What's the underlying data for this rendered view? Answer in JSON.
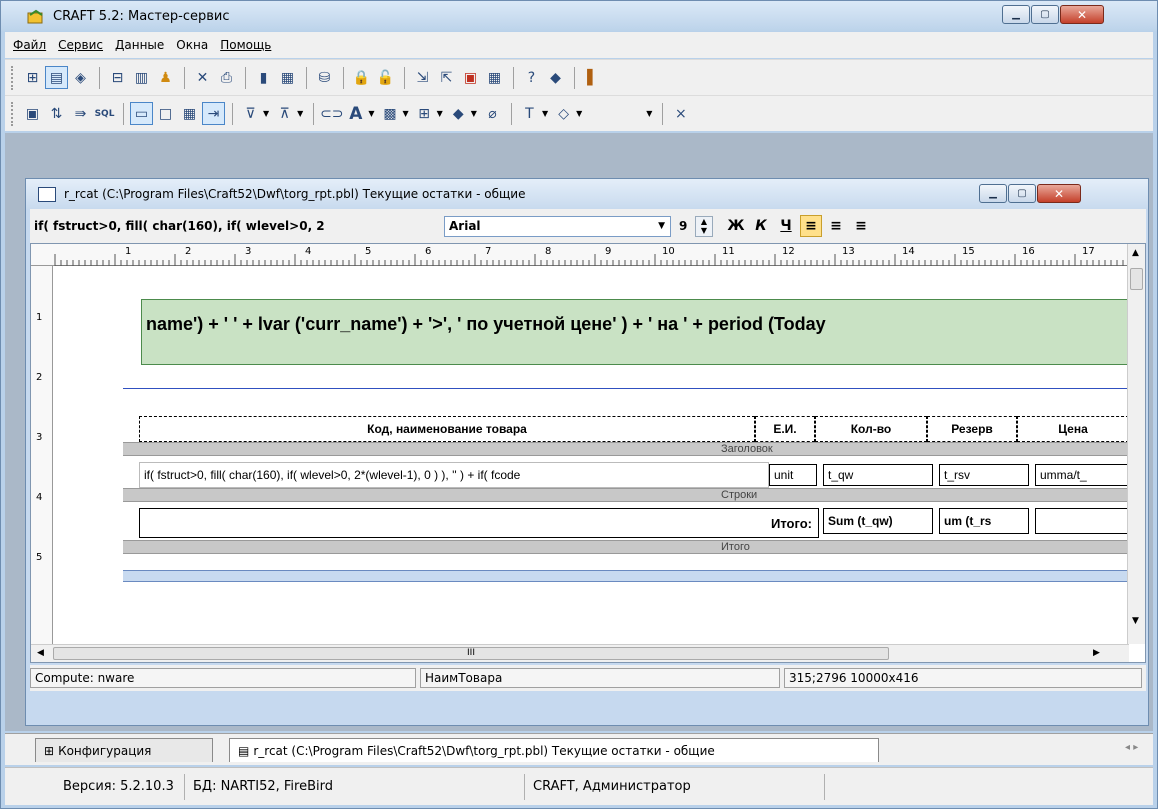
{
  "app": {
    "title": "CRAFT 5.2: Мастер-сервис"
  },
  "menu": [
    {
      "label": "Файл"
    },
    {
      "label": "Сервис"
    },
    {
      "label": "Данные"
    },
    {
      "label": "Окна"
    },
    {
      "label": "Помощь"
    }
  ],
  "child": {
    "title": "r_rcat (C:\\Program Files\\Craft52\\Dwf\\torg_rpt.pbl) Текущие остатки - общие",
    "expression": "if( fstruct>0, fill( char(160), if( wlevel>0, 2",
    "font": "Arial",
    "size": "9",
    "fmt_bold": "Ж",
    "fmt_italic": "К",
    "fmt_underline": "Ч"
  },
  "ruler": {
    "h": [
      "1",
      "2",
      "3",
      "4",
      "5",
      "6",
      "7",
      "8",
      "9",
      "10",
      "11",
      "12",
      "13",
      "14",
      "15",
      "16",
      "17"
    ],
    "v": [
      "1",
      "2",
      "3",
      "4",
      "5"
    ]
  },
  "report": {
    "title_text": "name') + '  ' + lvar ('curr_name') + '>', '  по учетной цене' ) + '  на ' + period (Today",
    "headers": [
      "Код, наименование товара",
      "Е.И.",
      "Кол-во",
      "Резерв",
      "Цена"
    ],
    "band_header": "Заголовок",
    "row_expr": "if( fstruct>0, fill( char(160), if( wlevel>0, 2*(wlevel-1), 0 ) ), '' ) + if( fcode",
    "row_unit": "unit",
    "row_qw": "t_qw",
    "row_rsv": "t_rsv",
    "row_summa": "umma/t_",
    "band_rows": "Строки",
    "total_label": "Итого:",
    "total_qw": "Sum (t_qw)",
    "total_rsv": "um (t_rs",
    "band_total": "Итого"
  },
  "scroll": {
    "h_thumb": "III"
  },
  "child_status": {
    "compute": "Compute: nware",
    "field": "НаимТовара",
    "pos": "315;2796  10000x416"
  },
  "tabs": [
    {
      "label": "Конфигурация"
    },
    {
      "label": "r_rcat (C:\\Program Files\\Craft52\\Dwf\\torg_rpt.pbl) Текущие остатки - общие"
    }
  ],
  "status": {
    "version": "Версия: 5.2.10.3",
    "db": "БД: NARTI52, FireBird",
    "user": "CRAFT, Администратор"
  }
}
